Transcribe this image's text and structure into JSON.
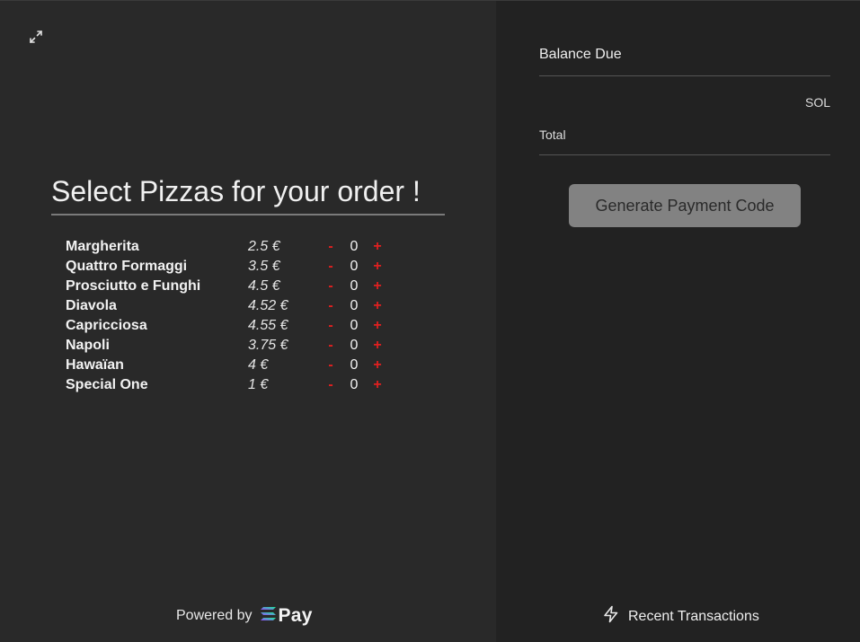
{
  "order": {
    "title": "Select Pizzas for your order !",
    "items": [
      {
        "name": "Margherita",
        "price": "2.5 €",
        "minus": "-",
        "qty": "0",
        "plus": "+"
      },
      {
        "name": "Quattro Formaggi",
        "price": "3.5 €",
        "minus": "-",
        "qty": "0",
        "plus": "+"
      },
      {
        "name": "Prosciutto e Funghi",
        "price": "4.5 €",
        "minus": "-",
        "qty": "0",
        "plus": "+"
      },
      {
        "name": "Diavola",
        "price": "4.52 €",
        "minus": "-",
        "qty": "0",
        "plus": "+"
      },
      {
        "name": "Capricciosa",
        "price": "4.55 €",
        "minus": "-",
        "qty": "0",
        "plus": "+"
      },
      {
        "name": "Napoli",
        "price": "3.75 €",
        "minus": "-",
        "qty": "0",
        "plus": "+"
      },
      {
        "name": "Hawaïan",
        "price": "4 €",
        "minus": "-",
        "qty": "0",
        "plus": "+"
      },
      {
        "name": "Special One",
        "price": "1 €",
        "minus": "-",
        "qty": "0",
        "plus": "+"
      }
    ]
  },
  "footer": {
    "powered_by": "Powered by",
    "brand": "Pay",
    "brand_icon": "solana-icon"
  },
  "payment": {
    "balance_label": "Balance Due",
    "currency": "SOL",
    "total_label": "Total",
    "generate_button": "Generate Payment Code",
    "recent_transactions": "Recent Transactions"
  },
  "icons": {
    "expand": "expand-icon",
    "recent": "lightning-icon"
  },
  "colors": {
    "left_bg": "#292929",
    "right_bg": "#222222",
    "accent_red": "#e02020",
    "button_bg": "#828282"
  }
}
